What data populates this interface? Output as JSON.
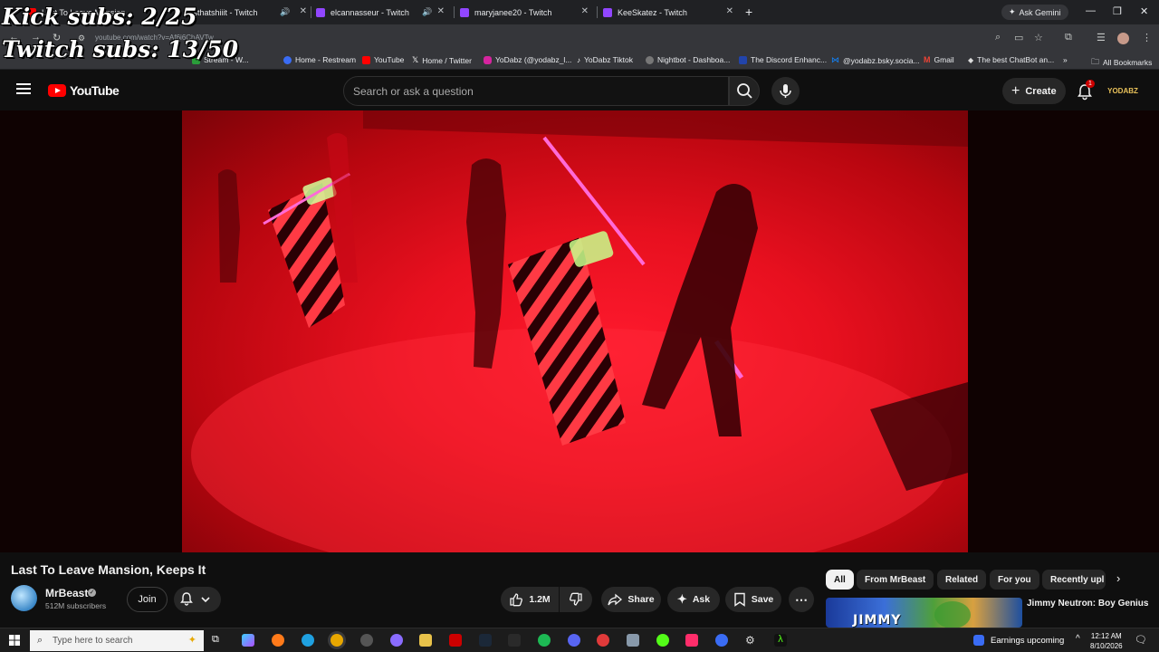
{
  "overlay": {
    "kick_subs": "Kick subs: 2/25",
    "twitch_subs": "Twitch subs: 13/50"
  },
  "browser": {
    "tabs": [
      {
        "title": "Last To Leave Mansion",
        "type": "youtube"
      },
      {
        "title": "thisthatshiiit - Twitch",
        "type": "twitch"
      },
      {
        "title": "elcannasseur - Twitch",
        "type": "twitch"
      },
      {
        "title": "maryjanee20 - Twitch",
        "type": "twitch"
      },
      {
        "title": "KeeSkatez - Twitch",
        "type": "twitch"
      }
    ],
    "new_tab": "+",
    "ask_gemini": "Ask Gemini",
    "url": "youtube.com/watch?v=Af6i6ChAVTw",
    "bookmarks": [
      {
        "label": "Stream - W...",
        "color": "#2a9d3a"
      },
      {
        "label": "Home - Restream",
        "color": "#3a6cf4"
      },
      {
        "label": "YouTube",
        "color": "#ff0000"
      },
      {
        "label": "Home / Twitter",
        "color": "#000000"
      },
      {
        "label": "YoDabz (@yodabz_l...",
        "color": "#d6249f"
      },
      {
        "label": "YoDabz Tiktok",
        "color": "#111111"
      },
      {
        "label": "Nightbot - Dashboa...",
        "color": "#555555"
      },
      {
        "label": "The Discord Enhanc...",
        "color": "#2244aa"
      },
      {
        "label": "@yodabz.bsky.socia...",
        "color": "#1185fe"
      },
      {
        "label": "Gmail",
        "color": "#ea4335"
      },
      {
        "label": "The best ChatBot an...",
        "color": "#cccccc"
      }
    ],
    "all_bookmarks": "All Bookmarks"
  },
  "youtube": {
    "logo_text": "YouTube",
    "search_placeholder": "Search or ask a question",
    "create_label": "Create",
    "notification_count": "1",
    "account_label": "YODABZ",
    "video": {
      "title": "Last To Leave Mansion, Keeps It",
      "channel": "MrBeast",
      "subscribers": "512M subscribers",
      "join_label": "Join",
      "likes": "1.2M",
      "share_label": "Share",
      "ask_label": "Ask",
      "save_label": "Save"
    },
    "chips": [
      "All",
      "From MrBeast",
      "Related",
      "For you",
      "Recently upl"
    ],
    "related": {
      "title": "Jimmy Neutron: Boy Genius",
      "thumb_text": "JIMMY"
    }
  },
  "taskbar": {
    "search_placeholder": "Type here to search",
    "earnings": "Earnings upcoming",
    "time": "12:12 AM",
    "date": "8/10/2026"
  }
}
